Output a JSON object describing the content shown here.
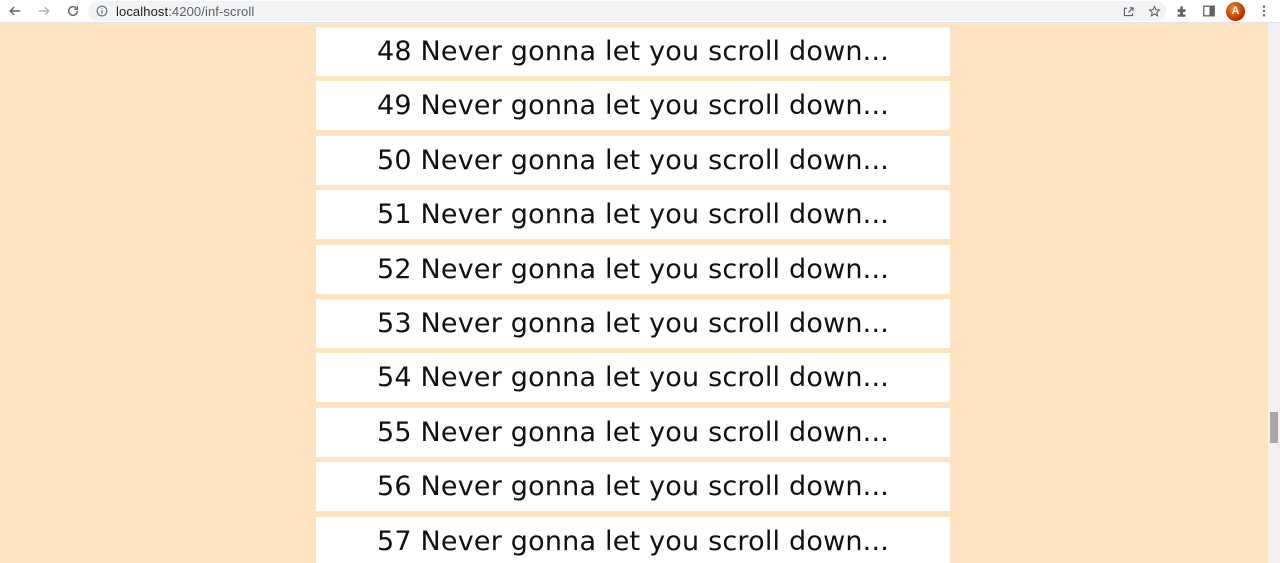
{
  "browser": {
    "url_host": "localhost",
    "url_path": ":4200/inf-scroll",
    "avatar_letter": "A"
  },
  "items": [
    "48 Never gonna let you scroll down...",
    "49 Never gonna let you scroll down...",
    "50 Never gonna let you scroll down...",
    "51 Never gonna let you scroll down...",
    "52 Never gonna let you scroll down...",
    "53 Never gonna let you scroll down...",
    "54 Never gonna let you scroll down...",
    "55 Never gonna let you scroll down...",
    "56 Never gonna let you scroll down...",
    "57 Never gonna let you scroll down..."
  ],
  "colors": {
    "page_background": "#ffe3c1",
    "item_background": "#ffffff"
  },
  "icons": [
    "back-icon",
    "forward-icon",
    "reload-icon",
    "info-icon",
    "share-icon",
    "bookmark-star-icon",
    "extensions-icon",
    "side-panel-icon",
    "menu-kebab-icon"
  ]
}
